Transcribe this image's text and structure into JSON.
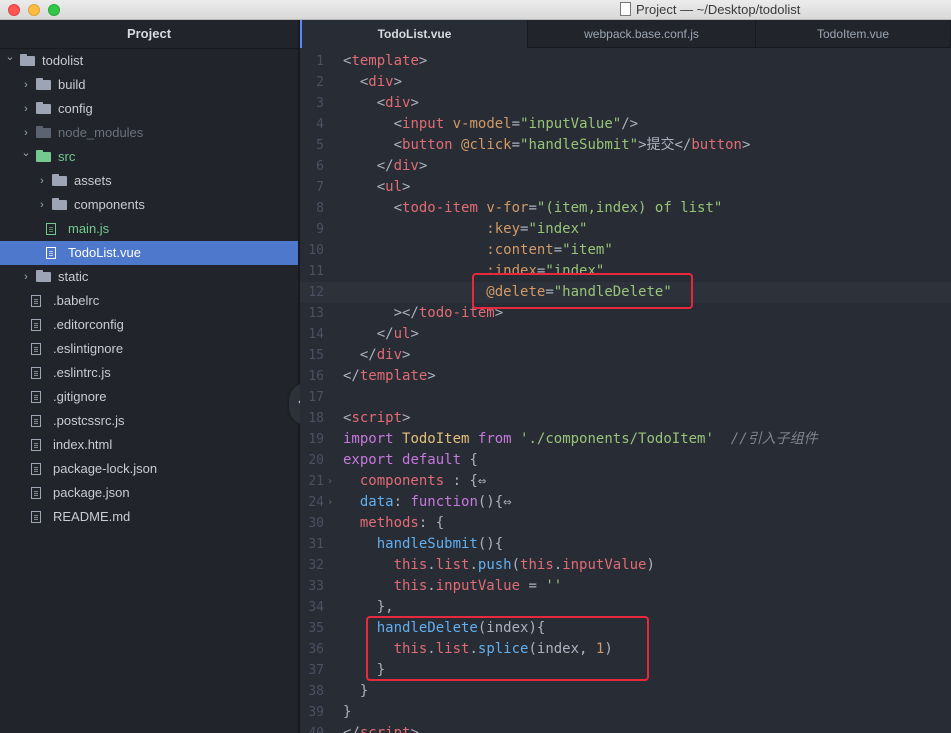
{
  "window": {
    "title": "Project — ~/Desktop/todolist"
  },
  "sidebar": {
    "header": "Project",
    "items": [
      {
        "label": "todolist",
        "type": "folder",
        "depth": 0,
        "chevron": "open",
        "state": "normal"
      },
      {
        "label": "build",
        "type": "folder",
        "depth": 1,
        "chevron": "closed",
        "state": "normal"
      },
      {
        "label": "config",
        "type": "folder",
        "depth": 1,
        "chevron": "closed",
        "state": "normal"
      },
      {
        "label": "node_modules",
        "type": "folder",
        "depth": 1,
        "chevron": "closed",
        "state": "dim"
      },
      {
        "label": "src",
        "type": "folder",
        "depth": 1,
        "chevron": "open",
        "state": "green"
      },
      {
        "label": "assets",
        "type": "folder",
        "depth": 2,
        "chevron": "closed",
        "state": "normal"
      },
      {
        "label": "components",
        "type": "folder",
        "depth": 2,
        "chevron": "closed",
        "state": "normal"
      },
      {
        "label": "main.js",
        "type": "file",
        "depth": 2,
        "chevron": "none",
        "state": "green"
      },
      {
        "label": "TodoList.vue",
        "type": "file",
        "depth": 2,
        "chevron": "none",
        "state": "selected"
      },
      {
        "label": "static",
        "type": "folder",
        "depth": 1,
        "chevron": "closed",
        "state": "normal"
      },
      {
        "label": ".babelrc",
        "type": "file",
        "depth": 1,
        "chevron": "none",
        "state": "normal"
      },
      {
        "label": ".editorconfig",
        "type": "file",
        "depth": 1,
        "chevron": "none",
        "state": "normal"
      },
      {
        "label": ".eslintignore",
        "type": "file",
        "depth": 1,
        "chevron": "none",
        "state": "normal"
      },
      {
        "label": ".eslintrc.js",
        "type": "file",
        "depth": 1,
        "chevron": "none",
        "state": "normal"
      },
      {
        "label": ".gitignore",
        "type": "file",
        "depth": 1,
        "chevron": "none",
        "state": "normal"
      },
      {
        "label": ".postcssrc.js",
        "type": "file",
        "depth": 1,
        "chevron": "none",
        "state": "normal"
      },
      {
        "label": "index.html",
        "type": "file",
        "depth": 1,
        "chevron": "none",
        "state": "normal"
      },
      {
        "label": "package-lock.json",
        "type": "file",
        "depth": 1,
        "chevron": "none",
        "state": "normal"
      },
      {
        "label": "package.json",
        "type": "file",
        "depth": 1,
        "chevron": "none",
        "state": "normal"
      },
      {
        "label": "README.md",
        "type": "file",
        "depth": 1,
        "chevron": "none",
        "state": "normal"
      }
    ],
    "toggle_glyph": "‹"
  },
  "tabs": [
    {
      "label": "TodoList.vue",
      "active": true
    },
    {
      "label": "webpack.base.conf.js",
      "active": false
    },
    {
      "label": "TodoItem.vue",
      "active": false
    }
  ],
  "colors": {
    "accent": "#4d78cc",
    "highlight_box": "#e8283c",
    "tag": "#e06c75",
    "attribute": "#d19a66",
    "string": "#98c379",
    "keyword": "#c678dd",
    "function": "#61afef"
  },
  "editor": {
    "lines": [
      {
        "num": "1",
        "fold": "",
        "tokens": [
          [
            "p",
            "<"
          ],
          [
            "tag",
            "template"
          ],
          [
            "p",
            ">"
          ]
        ]
      },
      {
        "num": "2",
        "fold": "",
        "tokens": [
          [
            "p",
            "  <"
          ],
          [
            "tag",
            "div"
          ],
          [
            "p",
            ">"
          ]
        ]
      },
      {
        "num": "3",
        "fold": "",
        "tokens": [
          [
            "p",
            "    <"
          ],
          [
            "tag",
            "div"
          ],
          [
            "p",
            ">"
          ]
        ]
      },
      {
        "num": "4",
        "fold": "",
        "tokens": [
          [
            "p",
            "      <"
          ],
          [
            "tag",
            "input"
          ],
          [
            "p",
            " "
          ],
          [
            "attr",
            "v-model"
          ],
          [
            "p",
            "="
          ],
          [
            "str",
            "\"inputValue\""
          ],
          [
            "p",
            "/>"
          ]
        ]
      },
      {
        "num": "5",
        "fold": "",
        "tokens": [
          [
            "p",
            "      <"
          ],
          [
            "tag",
            "button"
          ],
          [
            "p",
            " "
          ],
          [
            "attr",
            "@click"
          ],
          [
            "p",
            "="
          ],
          [
            "str",
            "\"handleSubmit\""
          ],
          [
            "p",
            ">提交</"
          ],
          [
            "tag",
            "button"
          ],
          [
            "p",
            ">"
          ]
        ]
      },
      {
        "num": "6",
        "fold": "",
        "tokens": [
          [
            "p",
            "    </"
          ],
          [
            "tag",
            "div"
          ],
          [
            "p",
            ">"
          ]
        ]
      },
      {
        "num": "7",
        "fold": "",
        "tokens": [
          [
            "p",
            "    <"
          ],
          [
            "tag",
            "ul"
          ],
          [
            "p",
            ">"
          ]
        ]
      },
      {
        "num": "8",
        "fold": "",
        "tokens": [
          [
            "p",
            "      <"
          ],
          [
            "tag",
            "todo-item"
          ],
          [
            "p",
            " "
          ],
          [
            "attr",
            "v-for"
          ],
          [
            "p",
            "="
          ],
          [
            "str",
            "\"(item,index) of list\""
          ]
        ]
      },
      {
        "num": "9",
        "fold": "",
        "tokens": [
          [
            "p",
            "                 "
          ],
          [
            "attr",
            ":key"
          ],
          [
            "p",
            "="
          ],
          [
            "str",
            "\"index\""
          ]
        ]
      },
      {
        "num": "10",
        "fold": "",
        "tokens": [
          [
            "p",
            "                 "
          ],
          [
            "attr",
            ":content"
          ],
          [
            "p",
            "="
          ],
          [
            "str",
            "\"item\""
          ]
        ]
      },
      {
        "num": "11",
        "fold": "",
        "tokens": [
          [
            "p",
            "                 "
          ],
          [
            "attr",
            ":index"
          ],
          [
            "p",
            "="
          ],
          [
            "str",
            "\"index\""
          ]
        ]
      },
      {
        "num": "12",
        "fold": "",
        "cursor": true,
        "tokens": [
          [
            "p",
            "                 "
          ],
          [
            "attr",
            "@delete"
          ],
          [
            "p",
            "="
          ],
          [
            "str",
            "\"handleDelete\""
          ]
        ]
      },
      {
        "num": "13",
        "fold": "",
        "tokens": [
          [
            "p",
            "      ></"
          ],
          [
            "tag",
            "todo-item"
          ],
          [
            "p",
            ">"
          ]
        ]
      },
      {
        "num": "14",
        "fold": "",
        "tokens": [
          [
            "p",
            "    </"
          ],
          [
            "tag",
            "ul"
          ],
          [
            "p",
            ">"
          ]
        ]
      },
      {
        "num": "15",
        "fold": "",
        "tokens": [
          [
            "p",
            "  </"
          ],
          [
            "tag",
            "div"
          ],
          [
            "p",
            ">"
          ]
        ]
      },
      {
        "num": "16",
        "fold": "",
        "tokens": [
          [
            "p",
            "</"
          ],
          [
            "tag",
            "template"
          ],
          [
            "p",
            ">"
          ]
        ]
      },
      {
        "num": "17",
        "fold": "",
        "tokens": []
      },
      {
        "num": "18",
        "fold": "",
        "tokens": [
          [
            "p",
            "<"
          ],
          [
            "tag",
            "script"
          ],
          [
            "p",
            ">"
          ]
        ]
      },
      {
        "num": "19",
        "fold": "",
        "tokens": [
          [
            "kw",
            "import"
          ],
          [
            "p",
            " "
          ],
          [
            "cls",
            "TodoItem"
          ],
          [
            "p",
            " "
          ],
          [
            "kw",
            "from"
          ],
          [
            "p",
            " "
          ],
          [
            "str",
            "'./components/TodoItem'"
          ],
          [
            "p",
            "  "
          ],
          [
            "com",
            "//引入子组件"
          ]
        ]
      },
      {
        "num": "20",
        "fold": "",
        "tokens": [
          [
            "kw",
            "export"
          ],
          [
            "p",
            " "
          ],
          [
            "kw",
            "default"
          ],
          [
            "p",
            " {"
          ]
        ]
      },
      {
        "num": "21",
        "fold": "›",
        "tokens": [
          [
            "p",
            "  "
          ],
          [
            "prop",
            "components"
          ],
          [
            "p",
            " : {⇔"
          ]
        ]
      },
      {
        "num": "24",
        "fold": "›",
        "tokens": [
          [
            "p",
            "  "
          ],
          [
            "fn",
            "data"
          ],
          [
            "p",
            ": "
          ],
          [
            "kw",
            "function"
          ],
          [
            "p",
            "(){⇔"
          ]
        ]
      },
      {
        "num": "30",
        "fold": "",
        "tokens": [
          [
            "p",
            "  "
          ],
          [
            "prop",
            "methods"
          ],
          [
            "p",
            ": {"
          ]
        ]
      },
      {
        "num": "31",
        "fold": "",
        "tokens": [
          [
            "p",
            "    "
          ],
          [
            "fn",
            "handleSubmit"
          ],
          [
            "p",
            "(){"
          ]
        ]
      },
      {
        "num": "32",
        "fold": "",
        "tokens": [
          [
            "p",
            "      "
          ],
          [
            "prop",
            "this"
          ],
          [
            "p",
            "."
          ],
          [
            "prop",
            "list"
          ],
          [
            "p",
            "."
          ],
          [
            "fn",
            "push"
          ],
          [
            "p",
            "("
          ],
          [
            "prop",
            "this"
          ],
          [
            "p",
            "."
          ],
          [
            "prop",
            "inputValue"
          ],
          [
            "p",
            ")"
          ]
        ]
      },
      {
        "num": "33",
        "fold": "",
        "tokens": [
          [
            "p",
            "      "
          ],
          [
            "prop",
            "this"
          ],
          [
            "p",
            "."
          ],
          [
            "prop",
            "inputValue"
          ],
          [
            "p",
            " = "
          ],
          [
            "str",
            "''"
          ]
        ]
      },
      {
        "num": "34",
        "fold": "",
        "tokens": [
          [
            "p",
            "    },"
          ]
        ]
      },
      {
        "num": "35",
        "fold": "",
        "tokens": [
          [
            "p",
            "    "
          ],
          [
            "fn",
            "handleDelete"
          ],
          [
            "p",
            "(index){"
          ]
        ]
      },
      {
        "num": "36",
        "fold": "",
        "tokens": [
          [
            "p",
            "      "
          ],
          [
            "prop",
            "this"
          ],
          [
            "p",
            "."
          ],
          [
            "prop",
            "list"
          ],
          [
            "p",
            "."
          ],
          [
            "fn",
            "splice"
          ],
          [
            "p",
            "(index, "
          ],
          [
            "num",
            "1"
          ],
          [
            "p",
            ")"
          ]
        ]
      },
      {
        "num": "37",
        "fold": "",
        "tokens": [
          [
            "p",
            "    }"
          ]
        ]
      },
      {
        "num": "38",
        "fold": "",
        "tokens": [
          [
            "p",
            "  }"
          ]
        ]
      },
      {
        "num": "39",
        "fold": "",
        "tokens": [
          [
            "p",
            "}"
          ]
        ]
      },
      {
        "num": "40",
        "fold": "",
        "tokens": [
          [
            "p",
            "</"
          ],
          [
            "tag",
            "script"
          ],
          [
            "p",
            ">"
          ]
        ]
      }
    ]
  }
}
